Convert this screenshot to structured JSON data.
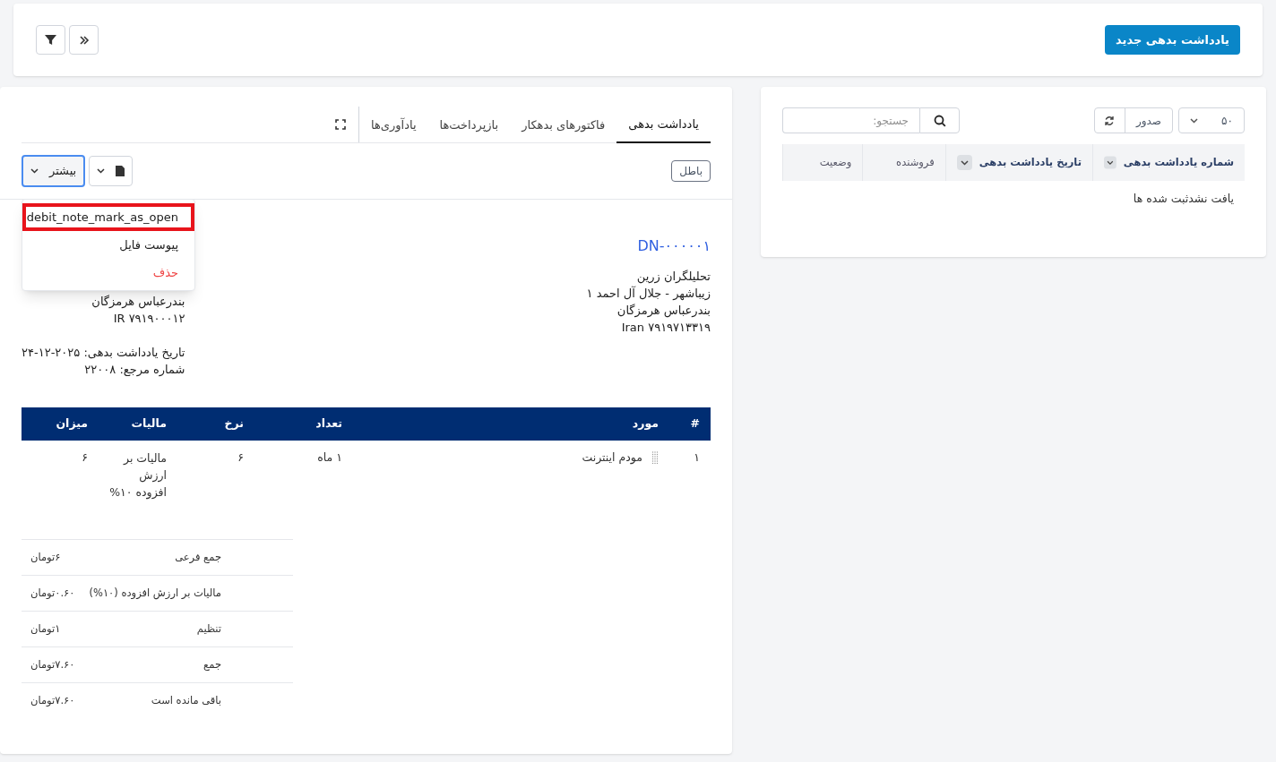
{
  "header": {
    "new_button": "یادداشت بدهی جدید"
  },
  "list_panel": {
    "per_page": "۵۰",
    "export_button": "صدور",
    "search": {
      "placeholder": "جستجو:"
    },
    "columns": [
      {
        "label": "شماره یادداشت بدهی",
        "sortable": true
      },
      {
        "label": "تاریخ یادداشت بدهی",
        "sortable": true
      },
      {
        "label": "فروشنده",
        "sortable": false
      },
      {
        "label": "وضعیت",
        "sortable": false
      }
    ],
    "empty_message": "یافت نشدثبت شده ها"
  },
  "detail_panel": {
    "tabs": [
      {
        "label": "یادداشت بدهی",
        "selected": true
      },
      {
        "label": "فاکتورهای بدهکار",
        "selected": false
      },
      {
        "label": "بازپرداخت‌ها",
        "selected": false
      },
      {
        "label": "یادآوری‌ها",
        "selected": false
      }
    ],
    "status_badge": "باطل",
    "more_button": "بیشتر",
    "menu": [
      {
        "label": "debit_note_mark_as_open",
        "kind": "normal",
        "highlighted": true
      },
      {
        "label": "پیوست فایل",
        "kind": "normal",
        "highlighted": false
      },
      {
        "label": "حذف",
        "kind": "danger",
        "highlighted": false
      }
    ],
    "note_number": "DN-۰۰۰۰۰۱",
    "from_lines": [
      "تحلیلگران زرین",
      "زیباشهر - جلال آل احمد ۱",
      "بندرعباس هرمزگان",
      "Iran ۷۹۱۹۷۱۳۳۱۹"
    ],
    "to_lines": [
      "بندرعباس هرمزگان",
      "IR ۷۹۱۹۰۰۰۱۲"
    ],
    "meta_lines": [
      "تاریخ یادداشت بدهی: ۲۰۲۵-۱۲-۲۴",
      "شماره مرجع: ۲۲۰۰۸"
    ],
    "items_table": {
      "columns": [
        "#",
        "مورد",
        "تعداد",
        "نرخ",
        "مالیات",
        "میزان"
      ],
      "rows": [
        {
          "number": "۱",
          "item": "مودم اینترنت",
          "quantity": "۱ ماه",
          "rate": "۶",
          "tax": "مالیات بر ارزش افزوده ۱۰%",
          "amount": "۶"
        }
      ]
    },
    "totals": [
      {
        "label": "جمع فرعی",
        "value": "۶تومان"
      },
      {
        "label": "مالیات بر ارزش افزوده (۱۰%)",
        "value": "۰.۶۰تومان"
      },
      {
        "label": "تنظیم",
        "value": "۱تومان"
      },
      {
        "label": "جمع",
        "value": "۷.۶۰تومان"
      },
      {
        "label": "باقی مانده است",
        "value": "۷.۶۰تومان"
      }
    ]
  }
}
